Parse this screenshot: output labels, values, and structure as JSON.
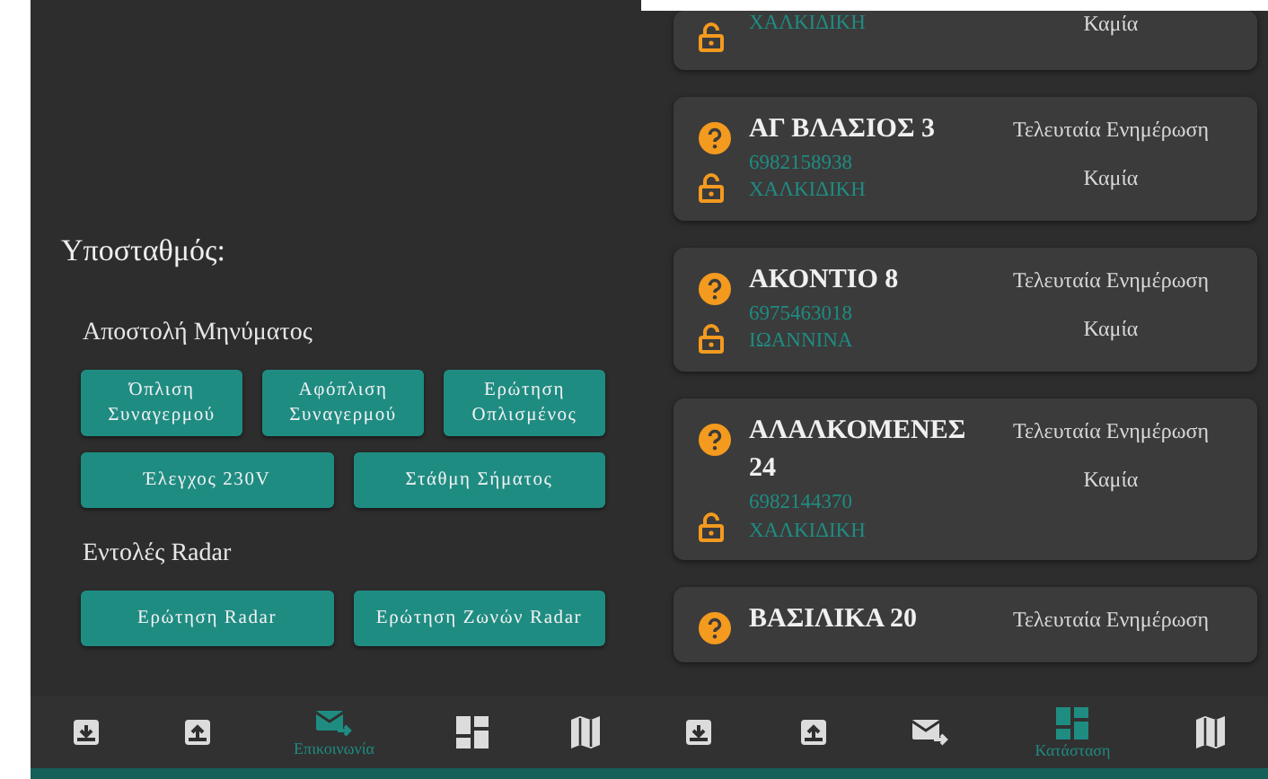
{
  "left_screen": {
    "title": "Υποσταθμός:",
    "sections": [
      {
        "heading": "Αποστολή Μηνύματος",
        "button_rows": [
          {
            "buttons": [
              "Όπλιση Συναγερμού",
              "Αφόπλιση Συναγερμού",
              "Ερώτηση Οπλισμένος"
            ]
          },
          {
            "buttons": [
              "Έλεγχος 230V",
              "Στάθμη Σήματος"
            ]
          }
        ]
      },
      {
        "heading": "Εντολές Radar",
        "button_rows": [
          {
            "buttons": [
              "Ερώτηση Radar",
              "Ερώτηση Ζωνών Radar"
            ]
          }
        ]
      }
    ],
    "nav": [
      {
        "kind": "download",
        "selected": false
      },
      {
        "kind": "upload",
        "selected": false
      },
      {
        "kind": "mail",
        "selected": true,
        "label": "Επικοινωνία"
      },
      {
        "kind": "dashboard",
        "selected": false
      },
      {
        "kind": "map",
        "selected": false
      }
    ]
  },
  "right_screen": {
    "cards": [
      {
        "region": "ΧΑΛΚΙΔΙΚΗ",
        "locked": false,
        "status_value": "Καμία"
      },
      {
        "name": "ΑΓ ΒΛΑΣΙΟΣ 3",
        "phone": "6982158938",
        "region": "ΧΑΛΚΙΔΙΚΗ",
        "locked": false,
        "status_label": "Τελευταία Ενημέρωση",
        "status_value": "Καμία"
      },
      {
        "name": "ΑΚΟΝΤΙΟ 8",
        "phone": "6975463018",
        "region": "ΙΩΑΝΝΙΝΑ",
        "locked": false,
        "status_label": "Τελευταία Ενημέρωση",
        "status_value": "Καμία"
      },
      {
        "name": "ΑΛΑΛΚΟΜΕΝΕΣ 24",
        "phone": "6982144370",
        "region": "ΧΑΛΚΙΔΙΚΗ",
        "locked": false,
        "status_label": "Τελευταία Ενημέρωση",
        "status_value": "Καμία"
      },
      {
        "name": "ΒΑΣΙΛΙΚΑ 20",
        "status_label": "Τελευταία Ενημέρωση"
      }
    ],
    "nav": [
      {
        "kind": "download",
        "selected": false
      },
      {
        "kind": "upload",
        "selected": false
      },
      {
        "kind": "mail",
        "selected": false
      },
      {
        "kind": "dashboard",
        "selected": true,
        "label": "Κατάσταση"
      },
      {
        "kind": "map",
        "selected": false
      }
    ]
  }
}
